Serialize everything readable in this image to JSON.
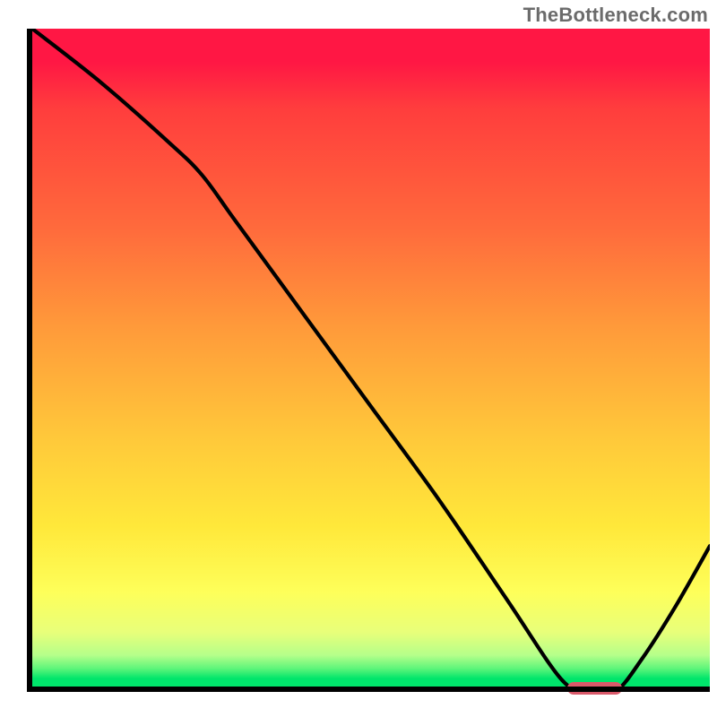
{
  "watermark": "TheBottleneck.com",
  "colors": {
    "axis": "#000000",
    "curve": "#000000",
    "marker": "#d9596a",
    "gradient_top": "#ff1744",
    "gradient_mid": "#ffd93a",
    "gradient_bottom": "#00e56b"
  },
  "chart_data": {
    "type": "line",
    "title": "",
    "xlabel": "",
    "ylabel": "",
    "xlim": [
      0,
      100
    ],
    "ylim": [
      0,
      100
    ],
    "x": [
      0,
      10,
      20,
      25,
      30,
      40,
      50,
      60,
      70,
      78,
      82,
      86,
      90,
      95,
      100
    ],
    "values": [
      100,
      92,
      83,
      78,
      71,
      57,
      43,
      29,
      14,
      2,
      0,
      0,
      5,
      13,
      22
    ],
    "marker": {
      "x_start": 79,
      "x_end": 87,
      "y": 0
    },
    "note": "Single black curve descending from top-left, flattening near x≈80–86 at y≈0 (optimal / green zone), then rising toward the right edge. Background is a vertical red→yellow→green bottleneck severity gradient."
  }
}
